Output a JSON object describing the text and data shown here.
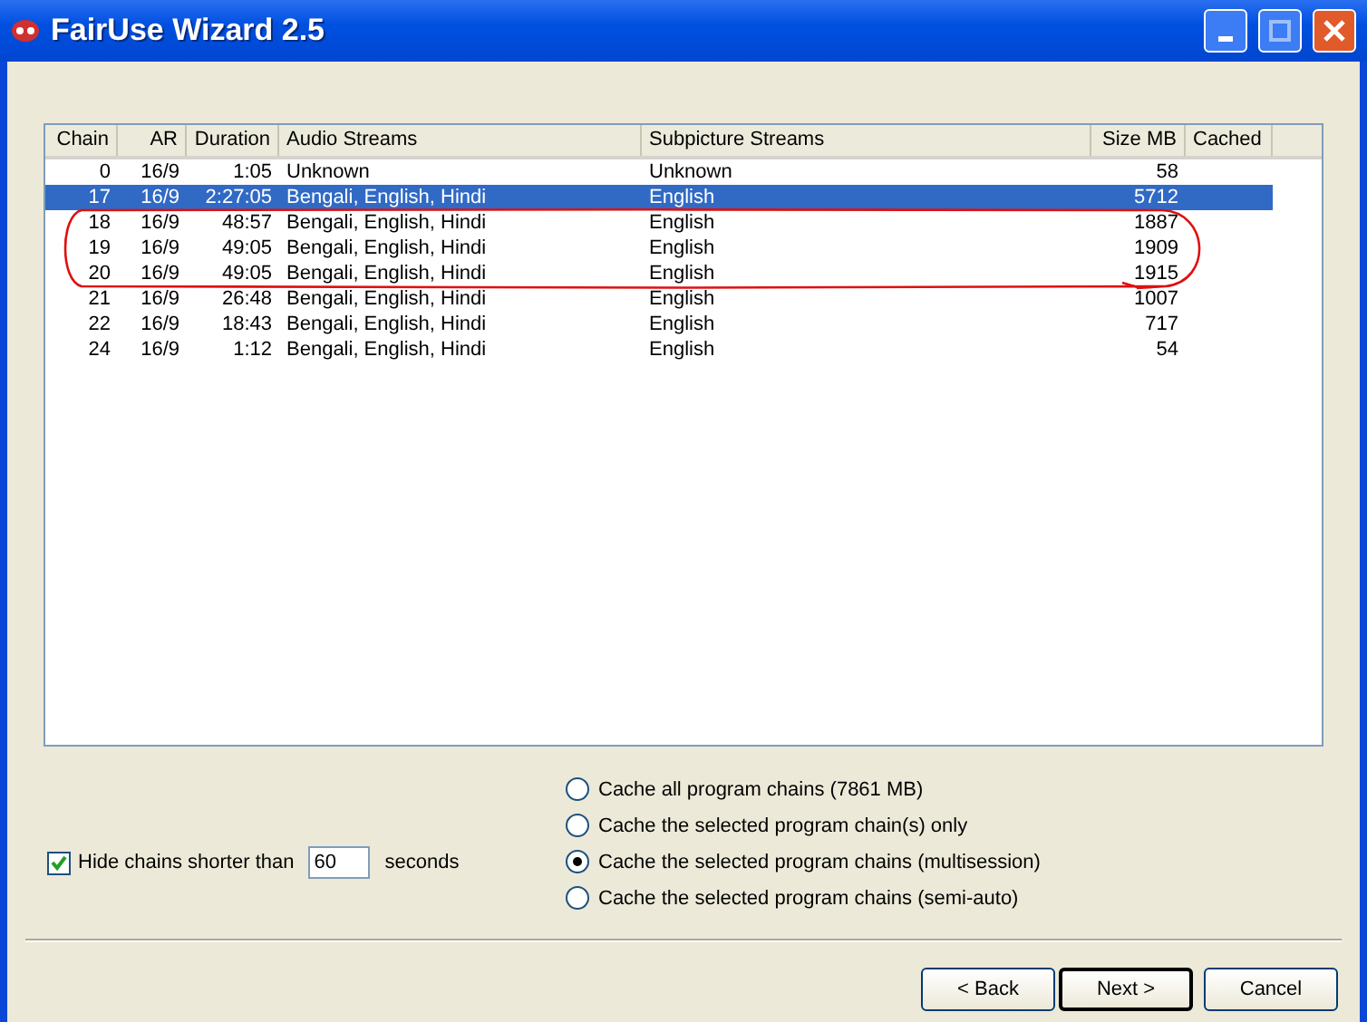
{
  "window": {
    "title": "FairUse Wizard 2.5"
  },
  "table": {
    "columns": [
      "Chain",
      "AR",
      "Duration",
      "Audio Streams",
      "Subpicture Streams",
      "Size MB",
      "Cached"
    ],
    "rows": [
      {
        "cells": [
          "0",
          "16/9",
          "1:05",
          "Unknown",
          "Unknown",
          "58",
          ""
        ],
        "selected": false
      },
      {
        "cells": [
          "17",
          "16/9",
          "2:27:05",
          "Bengali, English, Hindi",
          "English",
          "5712",
          ""
        ],
        "selected": true
      },
      {
        "cells": [
          "18",
          "16/9",
          "48:57",
          "Bengali, English, Hindi",
          "English",
          "1887",
          ""
        ],
        "selected": false
      },
      {
        "cells": [
          "19",
          "16/9",
          "49:05",
          "Bengali, English, Hindi",
          "English",
          "1909",
          ""
        ],
        "selected": false
      },
      {
        "cells": [
          "20",
          "16/9",
          "49:05",
          "Bengali, English, Hindi",
          "English",
          "1915",
          ""
        ],
        "selected": false
      },
      {
        "cells": [
          "21",
          "16/9",
          "26:48",
          "Bengali, English, Hindi",
          "English",
          "1007",
          ""
        ],
        "selected": false
      },
      {
        "cells": [
          "22",
          "16/9",
          "18:43",
          "Bengali, English, Hindi",
          "English",
          "717",
          ""
        ],
        "selected": false
      },
      {
        "cells": [
          "24",
          "16/9",
          "1:12",
          "Bengali, English, Hindi",
          "English",
          "54",
          ""
        ],
        "selected": false
      }
    ]
  },
  "hide_short": {
    "checked": true,
    "label": "Hide chains shorter than",
    "value": "60",
    "unit": "seconds"
  },
  "cache_options": [
    {
      "label": "Cache all program chains (7861 MB)",
      "selected": false
    },
    {
      "label": "Cache the selected program chain(s) only",
      "selected": false
    },
    {
      "label": "Cache the selected program chains (multisession)",
      "selected": true
    },
    {
      "label": "Cache the selected program chains (semi-auto)",
      "selected": false
    }
  ],
  "buttons": [
    {
      "label": "< Back",
      "default": false
    },
    {
      "label": "Next >",
      "default": true
    },
    {
      "label": "Cancel",
      "default": false
    }
  ]
}
